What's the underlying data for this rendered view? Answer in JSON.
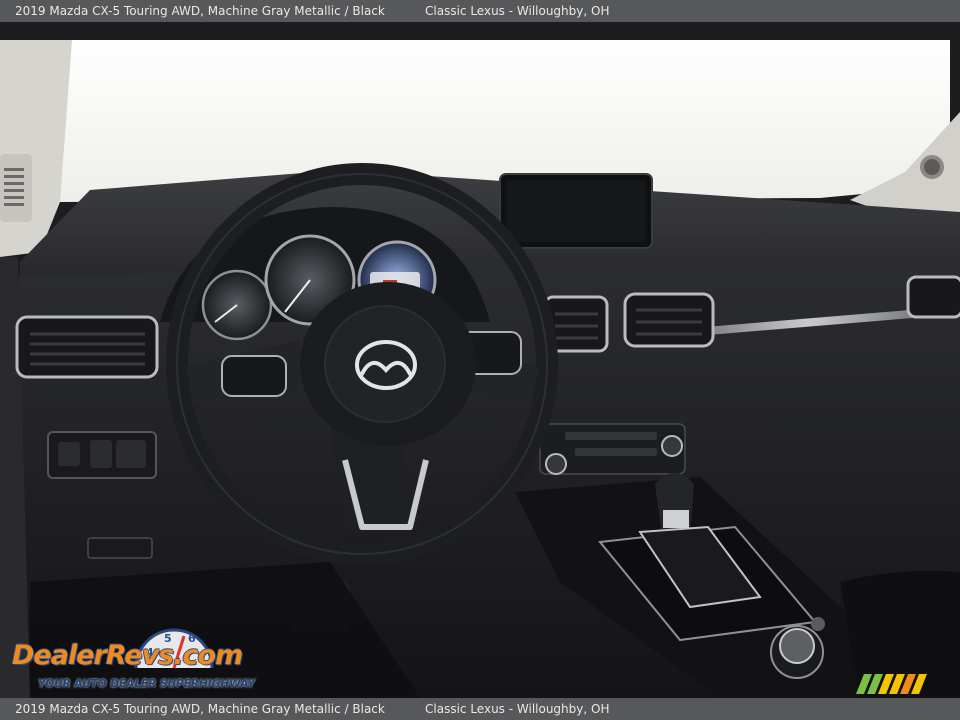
{
  "caption": {
    "vehicle": "2019 Mazda CX-5 Touring AWD,  Machine Gray Metallic / Black",
    "dealer": "Classic Lexus - Willoughby, OH"
  },
  "watermark": {
    "brand": "DealerRevs.com",
    "tagline": "YOUR AUTO DEALER SUPERHIGHWAY"
  },
  "colors": {
    "caption_bar": "#57585a",
    "caption_text": "#e8e8e8",
    "watermark_orange": "#f08a1c",
    "watermark_blue": "#1d3f7a",
    "stripe_green": "#7bc043",
    "stripe_yellow": "#f5c400"
  },
  "photo": {
    "subject": "interior dashboard",
    "icons": [
      "mazda-logo-icon",
      "steering-wheel-icon",
      "gear-shifter-icon",
      "dealerrevs-logo-icon",
      "speed-stripes-icon"
    ]
  }
}
